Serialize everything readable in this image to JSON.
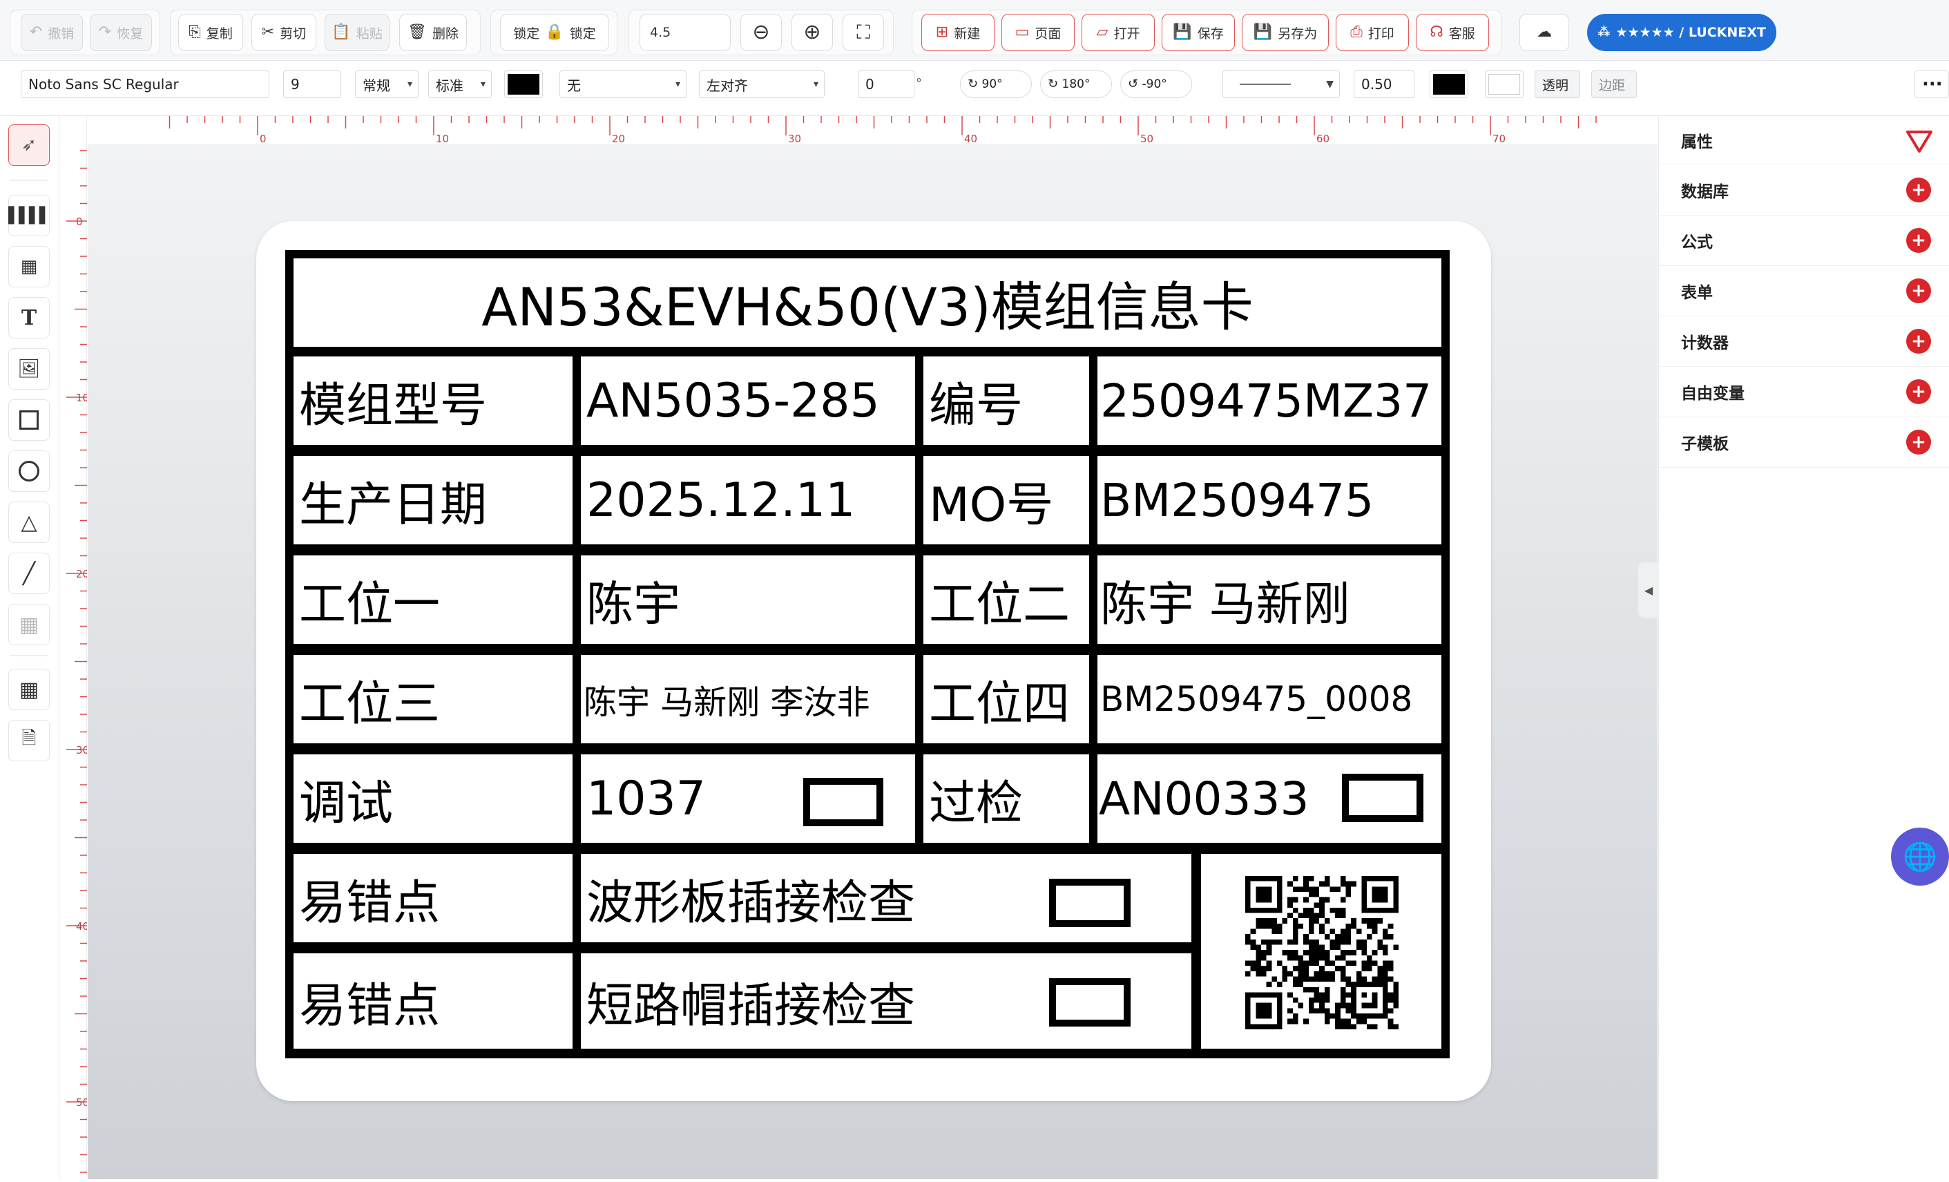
{
  "toolbar": {
    "undo": "撤销",
    "redo": "恢复",
    "copy": "复制",
    "cut": "剪切",
    "paste": "粘贴",
    "delete": "删除",
    "lock_a": "锁定",
    "lock_b": "锁定",
    "zoom_value": "4.5",
    "new": "新建",
    "page": "页面",
    "open": "打开",
    "save": "保存",
    "save_as": "另存为",
    "print": "打印",
    "service": "客服",
    "brand": "★★★★★ / LUCKNEXT"
  },
  "format": {
    "font": "Noto Sans SC Regular",
    "size": "9",
    "weight": "常规",
    "spacing": "标准",
    "decoration": "无",
    "align": "左对齐",
    "angle": "0",
    "degree": "°",
    "rot90": "90°",
    "rot180": "180°",
    "rotm90": "-90°",
    "stroke_width": "0.50",
    "transparent": "透明",
    "margin": "边距"
  },
  "ruler": {
    "h_ticks": [
      "0",
      "10",
      "20",
      "30",
      "40",
      "50",
      "60",
      "70"
    ],
    "v_ticks": [
      "0",
      "10",
      "20",
      "30",
      "40",
      "50"
    ]
  },
  "panel": {
    "title": "属性",
    "items": [
      "数据库",
      "公式",
      "表单",
      "计数器",
      "自由变量",
      "子模板"
    ]
  },
  "label": {
    "title": "AN53&EVH&50(V3)模组信息卡",
    "r1": [
      "模组型号",
      "AN5035-285",
      "编号",
      "2509475MZ37"
    ],
    "r2": [
      "生产日期",
      "2025.12.11",
      "MO号",
      "BM2509475"
    ],
    "r3": [
      "工位一",
      "陈宇",
      "工位二",
      "陈宇 马新刚"
    ],
    "r4": [
      "工位三",
      "陈宇 马新刚 李汝非",
      "工位四",
      "BM2509475_0008"
    ],
    "r5": [
      "调试",
      "1037",
      "过检",
      "AN00333"
    ],
    "r6": [
      "易错点",
      "波形板插接检查"
    ],
    "r7": [
      "易错点",
      "短路帽插接检查"
    ]
  },
  "colors": {
    "accent": "#d8262a",
    "brand": "#1f6fd6"
  }
}
